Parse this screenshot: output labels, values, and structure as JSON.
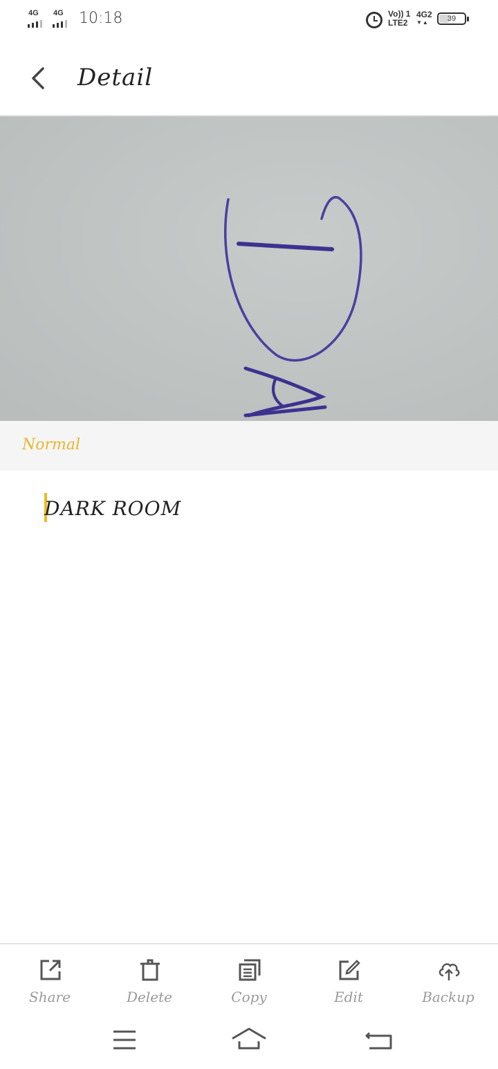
{
  "status_bar": {
    "sim1_network": "4G",
    "sim2_network": "4G",
    "time": "10:18",
    "volte_line1": "Vo)) 1",
    "volte_line2": "LTE2",
    "sim2_data": "4G2",
    "battery_level": "39"
  },
  "header": {
    "title": "Detail"
  },
  "mode": {
    "label": "Normal"
  },
  "content": {
    "recognized_text": "DARK ROOM"
  },
  "toolbar": {
    "share_label": "Share",
    "delete_label": "Delete",
    "copy_label": "Copy",
    "edit_label": "Edit",
    "backup_label": "Backup"
  },
  "colors": {
    "accent": "#e8b530",
    "caret": "#f2b91e",
    "ink": "#4a3fa0",
    "photo_background": "#bfc3c2"
  },
  "icons": [
    "back-arrow-icon",
    "share-icon",
    "delete-icon",
    "copy-icon",
    "edit-icon",
    "cloud-upload-icon",
    "menu-icon",
    "home-icon",
    "return-icon",
    "alarm-icon",
    "battery-icon",
    "signal-icon"
  ]
}
